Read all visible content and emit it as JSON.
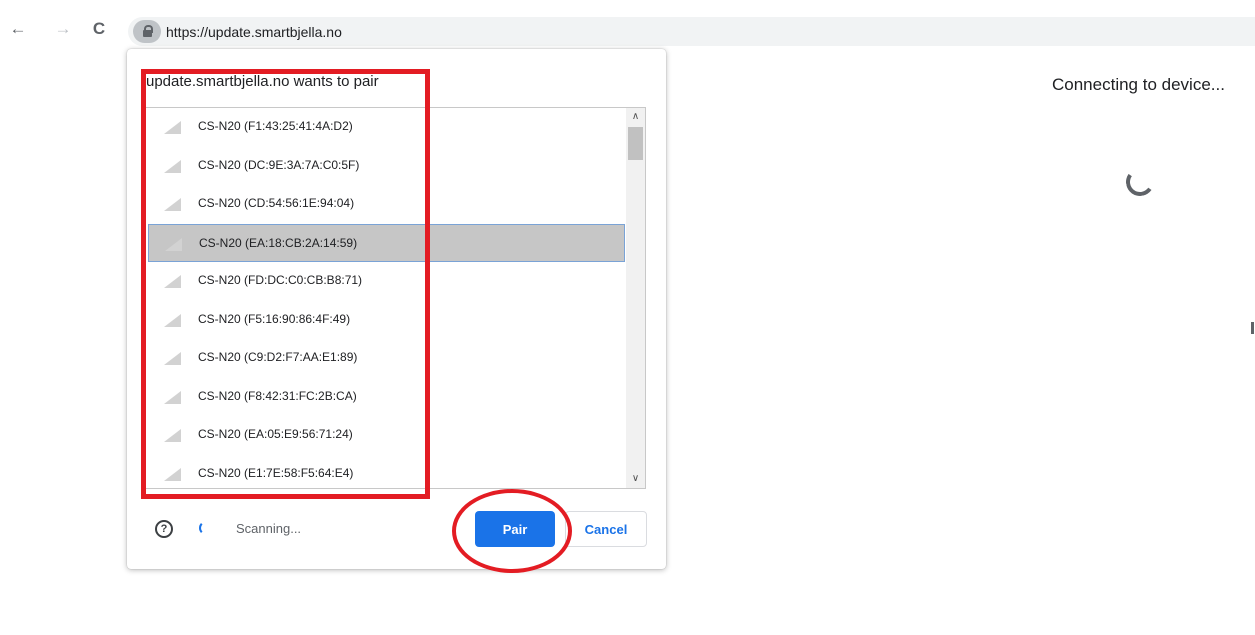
{
  "browser": {
    "back_icon": "←",
    "forward_icon": "→",
    "reload_icon": "C",
    "url": "https://update.smartbjella.no"
  },
  "page": {
    "status": "Connecting to device..."
  },
  "dialog": {
    "title": "update.smartbjella.no wants to pair",
    "devices": [
      {
        "label": "CS-N20 (F1:43:25:41:4A:D2)",
        "selected": false
      },
      {
        "label": "CS-N20 (DC:9E:3A:7A:C0:5F)",
        "selected": false
      },
      {
        "label": "CS-N20 (CD:54:56:1E:94:04)",
        "selected": false
      },
      {
        "label": "CS-N20 (EA:18:CB:2A:14:59)",
        "selected": true
      },
      {
        "label": "CS-N20 (FD:DC:C0:CB:B8:71)",
        "selected": false
      },
      {
        "label": "CS-N20 (F5:16:90:86:4F:49)",
        "selected": false
      },
      {
        "label": "CS-N20 (C9:D2:F7:AA:E1:89)",
        "selected": false
      },
      {
        "label": "CS-N20 (F8:42:31:FC:2B:CA)",
        "selected": false
      },
      {
        "label": "CS-N20 (EA:05:E9:56:71:24)",
        "selected": false
      },
      {
        "label": "CS-N20 (E1:7E:58:F5:64:E4)",
        "selected": false
      }
    ],
    "help_icon": "?",
    "scan_status": "Scanning...",
    "pair_label": "Pair",
    "cancel_label": "Cancel",
    "scroll_up_icon": "∧",
    "scroll_down_icon": "∨"
  },
  "annotation_color": "#e31c23",
  "accent_color": "#1a73e8"
}
